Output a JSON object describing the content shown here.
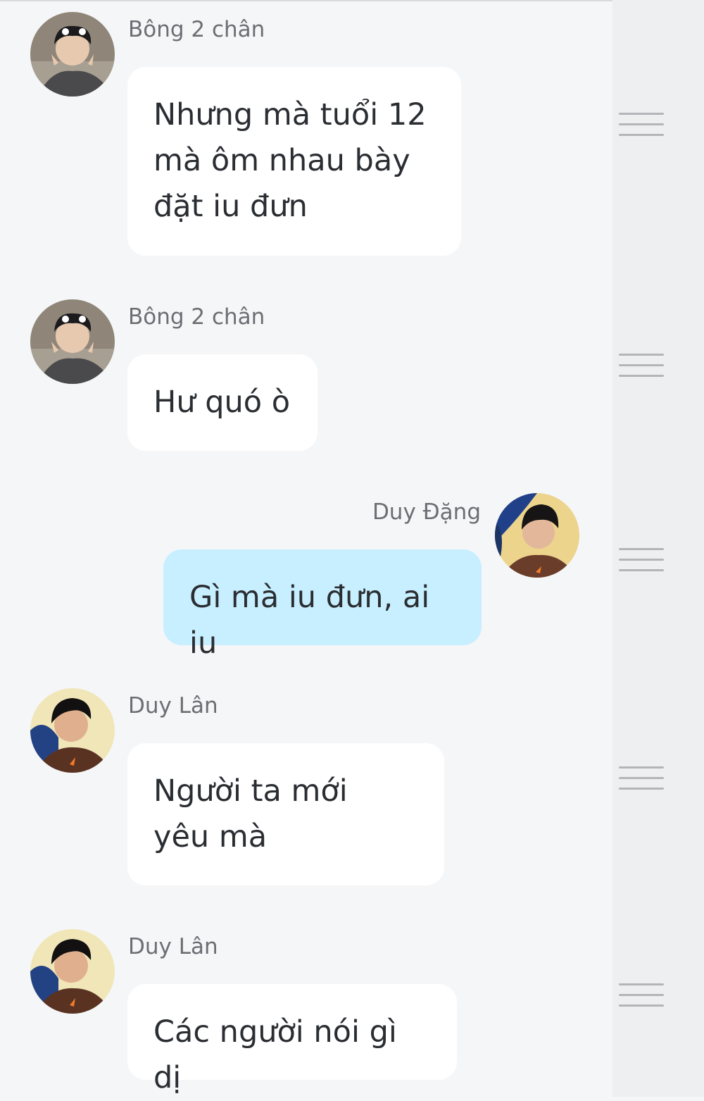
{
  "messages": [
    {
      "sender": "Bông 2 chân",
      "text": "Nhưng mà tuổi 12\nmà ôm nhau bày\nđặt iu đưn",
      "side": "left",
      "avatar": "avatar-bong-2-chan"
    },
    {
      "sender": "Bông 2 chân",
      "text": "Hư quó ò",
      "side": "left",
      "avatar": "avatar-bong-2-chan"
    },
    {
      "sender": "Duy Đặng",
      "text": "Gì mà iu đưn, ai iu",
      "side": "right",
      "avatar": "avatar-duy-dang"
    },
    {
      "sender": "Duy Lân",
      "text": "Người ta mới\nyêu mà",
      "side": "left",
      "avatar": "avatar-duy-lan"
    },
    {
      "sender": "Duy Lân",
      "text": "Các người nói gì dị",
      "side": "left",
      "avatar": "avatar-duy-lan"
    }
  ],
  "colors": {
    "background": "#f5f6f8",
    "bubble_other": "#ffffff",
    "bubble_mine": "#c8efff",
    "sender_text": "#6b6e73",
    "drag_handle": "#b3b5b9"
  },
  "icons": {
    "drag_handle": "drag-handle-icon"
  }
}
